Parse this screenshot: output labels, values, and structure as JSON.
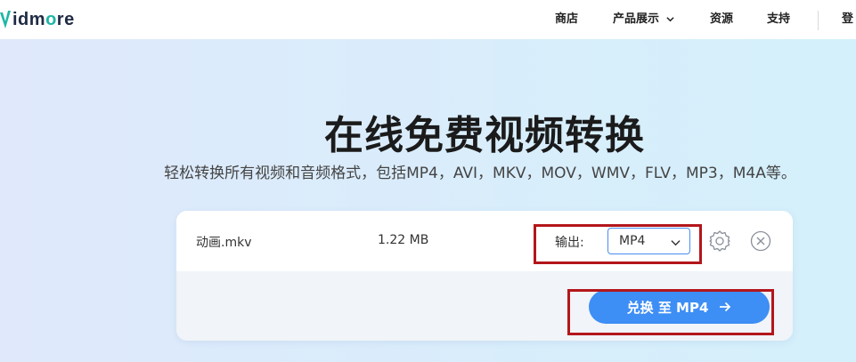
{
  "header": {
    "logo_text": "idmore",
    "nav": [
      {
        "label": "商店"
      },
      {
        "label": "产品展示"
      },
      {
        "label": "资源"
      },
      {
        "label": "支持"
      },
      {
        "label": "登"
      }
    ]
  },
  "hero": {
    "title": "在线免费视频转换",
    "subtitle": "轻松转换所有视频和音频格式，包括MP4，AVI，MKV，MOV，WMV，FLV，MP3，M4A等。"
  },
  "file": {
    "name": "动画.mkv",
    "size": "1.22 MB",
    "output_label": "输出:",
    "format": "MP4"
  },
  "convert_button": {
    "label": "兑换 至 MP4"
  },
  "colors": {
    "accent": "#3d8ef5",
    "highlight": "#b3161b",
    "logo_teal": "#1fb6a6"
  }
}
